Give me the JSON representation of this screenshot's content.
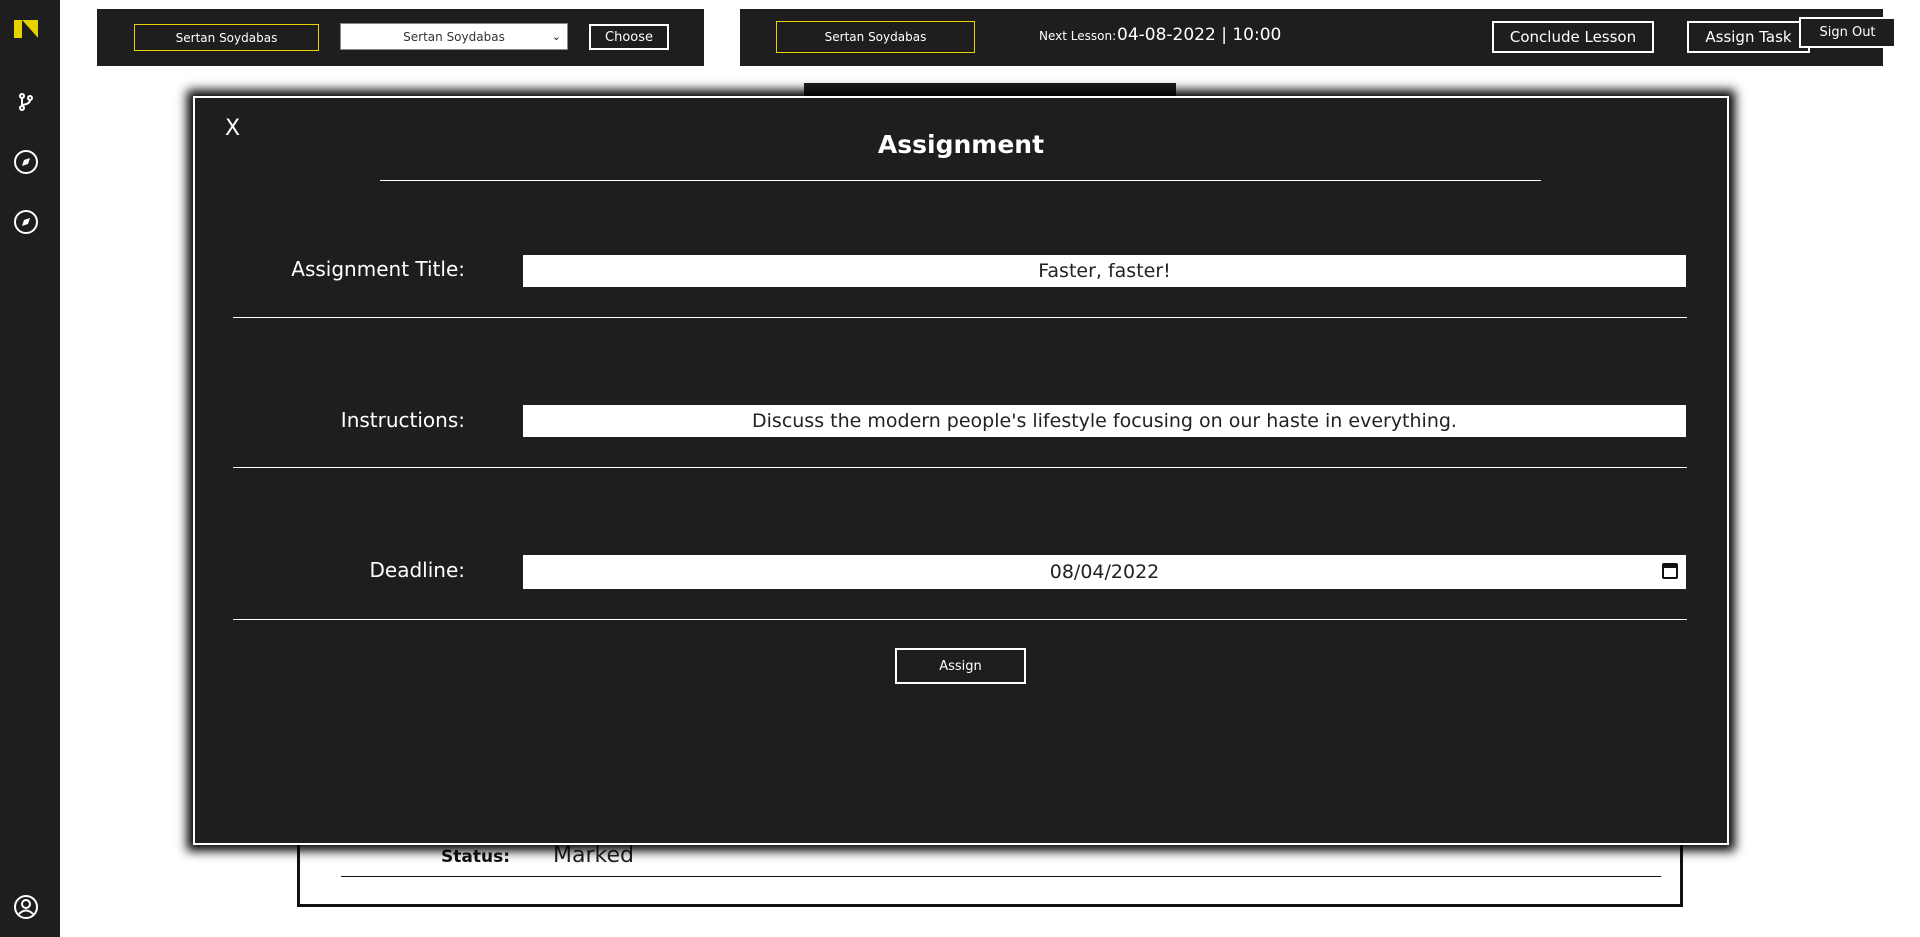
{
  "sidebar": {
    "items": [
      {
        "icon": "branch-icon"
      },
      {
        "icon": "compass-icon"
      },
      {
        "icon": "compass-icon"
      }
    ],
    "footer_icon": "user-circle-icon"
  },
  "student_bar": {
    "selected_student": "Sertan Soydabas",
    "select_value": "Sertan Soydabas",
    "choose_label": "Choose"
  },
  "lesson_bar": {
    "student": "Sertan Soydabas",
    "next_lesson_label": "Next Lesson:",
    "next_lesson_value": "04-08-2022 | 10:00",
    "conclude_label": "Conclude Lesson",
    "assign_task_label": "Assign Task"
  },
  "sign_out_label": "Sign Out",
  "background_card": {
    "status_label": "Status:",
    "status_value": "Marked"
  },
  "modal": {
    "close_label": "X",
    "title": "Assignment",
    "fields": {
      "title_label": "Assignment Title:",
      "title_value": "Faster, faster!",
      "instructions_label": "Instructions:",
      "instructions_value": "Discuss the modern people's lifestyle focusing on our haste in everything.",
      "deadline_label": "Deadline:",
      "deadline_value": "08/04/2022"
    },
    "assign_label": "Assign"
  },
  "colors": {
    "panel": "#1e1e1e",
    "accent_yellow": "#e6d300",
    "text": "#ffffff"
  }
}
